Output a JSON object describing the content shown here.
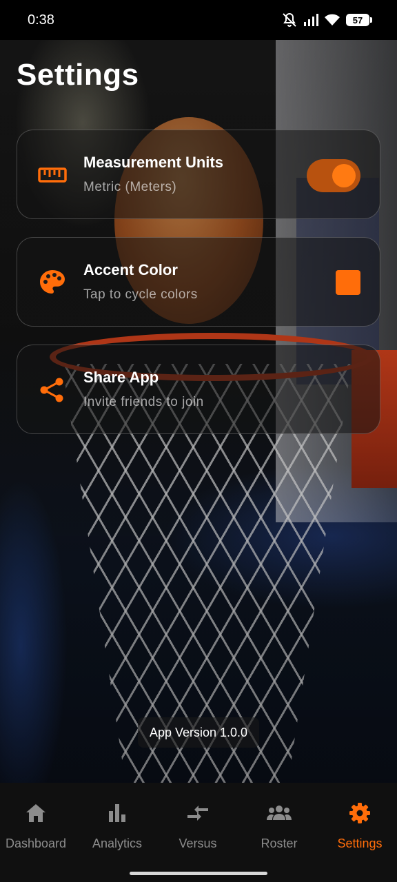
{
  "status_bar": {
    "time": "0:38",
    "battery_level": "57",
    "icons": [
      "mute-icon",
      "signal-icon",
      "wifi-icon",
      "battery-icon"
    ]
  },
  "page": {
    "title": "Settings"
  },
  "settings": [
    {
      "title": "Measurement Units",
      "subtitle": "Metric (Meters)",
      "icon": "ruler-icon",
      "control": "toggle",
      "toggle_on": true
    },
    {
      "title": "Accent Color",
      "subtitle": "Tap to cycle colors",
      "icon": "palette-icon",
      "control": "color-swatch",
      "swatch_color": "#ff6d0a"
    },
    {
      "title": "Share App",
      "subtitle": "Invite friends to join",
      "icon": "share-icon",
      "control": "none"
    }
  ],
  "footer": {
    "version": "App Version 1.0.0"
  },
  "bottom_nav": {
    "items": [
      {
        "label": "Dashboard",
        "icon": "home-icon",
        "active": false
      },
      {
        "label": "Analytics",
        "icon": "bar-chart-icon",
        "active": false
      },
      {
        "label": "Versus",
        "icon": "compare-arrows-icon",
        "active": false
      },
      {
        "label": "Roster",
        "icon": "group-icon",
        "active": false
      },
      {
        "label": "Settings",
        "icon": "gear-icon",
        "active": true
      }
    ]
  },
  "colors": {
    "accent": "#ff6d0a",
    "toggle_track": "#b8520f",
    "inactive_nav": "#8c8c8c",
    "nav_background": "#101010"
  }
}
